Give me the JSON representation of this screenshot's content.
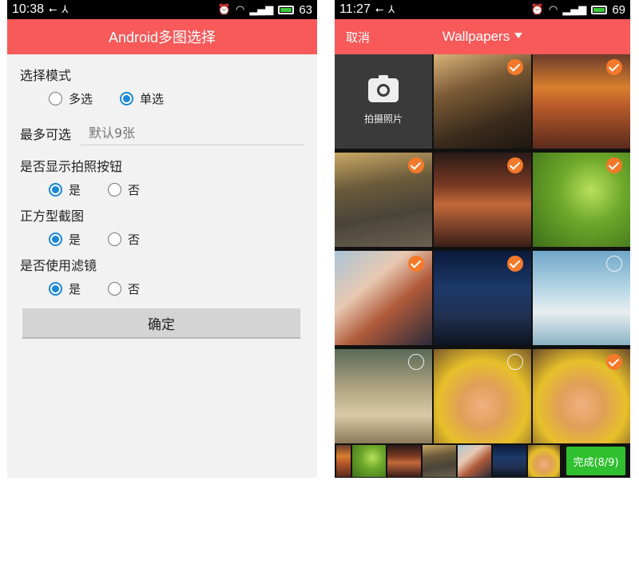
{
  "left_phone": {
    "status_bar": {
      "time": "10:38",
      "battery": "63"
    },
    "title": "Android多图选择",
    "mode": {
      "label": "选择模式",
      "options": [
        "多选",
        "单选"
      ]
    },
    "max_select": {
      "label": "最多可选",
      "placeholder": "默认9张"
    },
    "show_camera": {
      "label": "是否显示拍照按钮",
      "options": [
        "是",
        "否"
      ]
    },
    "square_crop": {
      "label": "正方型截图",
      "options": [
        "是",
        "否"
      ]
    },
    "use_filter": {
      "label": "是否使用滤镜",
      "options": [
        "是",
        "否"
      ]
    },
    "confirm_label": "确定"
  },
  "right_phone": {
    "status_bar": {
      "time": "11:27",
      "battery": "69"
    },
    "cancel_label": "取消",
    "album_name": "Wallpapers",
    "camera_tile_label": "拍摄照片",
    "photos": [
      {
        "selected": true
      },
      {
        "selected": true
      },
      {
        "selected": true
      },
      {
        "selected": true
      },
      {
        "selected": true
      },
      {
        "selected": true
      },
      {
        "selected": true
      },
      {
        "selected": false
      },
      {
        "selected": false
      },
      {
        "selected": false
      },
      {
        "selected": true
      }
    ],
    "done_label": "完成(8/9)"
  },
  "colors": {
    "title_bar": "#f85959",
    "radio_accent": "#1a88d6",
    "check_accent": "#f5792a",
    "done_button": "#2fbf2f"
  }
}
